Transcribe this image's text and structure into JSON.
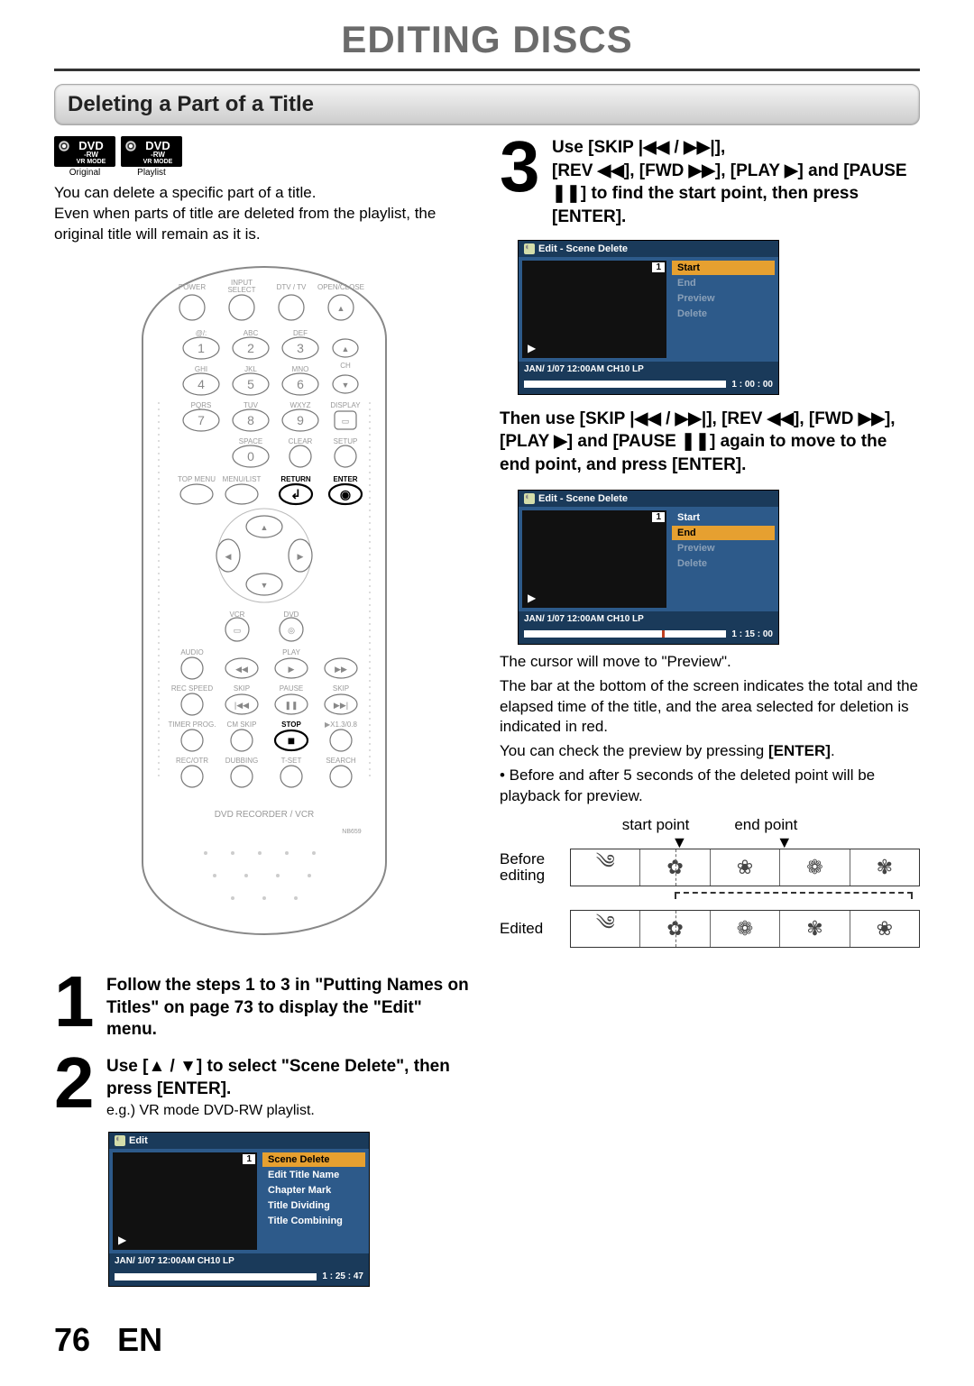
{
  "page_title": "EDITING DISCS",
  "section_title": "Deleting a Part of a Title",
  "badges": [
    {
      "line1": "DVD",
      "line2": "-RW",
      "line3": "VR MODE",
      "sub": "Original"
    },
    {
      "line1": "DVD",
      "line2": "-RW",
      "line3": "VR MODE",
      "sub": "Playlist"
    }
  ],
  "intro_lines": [
    "You can delete a specific part of a title.",
    "Even when parts of title are deleted from the playlist, the original title will remain as it is."
  ],
  "remote": {
    "rows": [
      [
        "POWER",
        "INPUT SELECT",
        "DTV / TV",
        "OPEN/CLOSE"
      ],
      [
        "@/:",
        "ABC",
        "DEF",
        ""
      ],
      [
        "1",
        "2",
        "3",
        "▲"
      ],
      [
        "GHI",
        "JKL",
        "MNO",
        "CH"
      ],
      [
        "4",
        "5",
        "6",
        "▼"
      ],
      [
        "PQRS",
        "TUV",
        "WXYZ",
        "DISPLAY"
      ],
      [
        "7",
        "8",
        "9",
        "■"
      ],
      [
        "",
        "SPACE",
        "CLEAR",
        "SETUP"
      ],
      [
        "",
        "0",
        "",
        ""
      ],
      [
        "TOP MENU",
        "MENU/LIST",
        "RETURN",
        "ENTER"
      ]
    ],
    "vcr_dvd": [
      "VCR",
      "DVD"
    ],
    "transport": [
      [
        "AUDIO",
        "",
        "PLAY",
        ""
      ],
      [
        "",
        "◀◀",
        "▶",
        "▶▶"
      ],
      [
        "REC SPEED",
        "SKIP",
        "PAUSE",
        "SKIP"
      ],
      [
        "",
        "|◀◀",
        "❚❚",
        "▶▶|"
      ],
      [
        "TIMER PROG.",
        "CM SKIP",
        "STOP",
        "▶X1.3/0.8"
      ],
      [
        "",
        "",
        "■",
        ""
      ],
      [
        "REC/OTR",
        "DUBBING",
        "T-SET",
        "SEARCH"
      ]
    ],
    "brand": "DVD RECORDER / VCR",
    "model": "NB659"
  },
  "step1": {
    "num": "1",
    "text": "Follow the steps 1 to 3 in \"Putting Names on Titles\" on page 73 to display the \"Edit\" menu."
  },
  "step2": {
    "num": "2",
    "text": "Use [▲ / ▼] to select \"Scene Delete\", then press [ENTER].",
    "sub": "e.g.) VR mode DVD-RW playlist.",
    "osd": {
      "title": "Edit",
      "preview_num": "1",
      "options": [
        "Scene Delete",
        "Edit Title Name",
        "Chapter Mark",
        "Title Dividing",
        "Title Combining"
      ],
      "highlight_index": 0,
      "info": "JAN/ 1/07 12:00AM CH10   LP",
      "time": "1 : 25 : 47"
    }
  },
  "step3": {
    "num": "3",
    "head_a": "Use [SKIP |◀◀ / ▶▶|],",
    "head_b": "[REV ◀◀], [FWD ▶▶], [PLAY ▶] and [PAUSE ❚❚] to find the start point, then press [ENTER].",
    "osd1": {
      "title": "Edit - Scene Delete",
      "preview_num": "1",
      "options": [
        "Start",
        "End",
        "Preview",
        "Delete"
      ],
      "highlight_index": 0,
      "info": "JAN/ 1/07 12:00AM CH10   LP",
      "time": "1 : 00 : 00"
    },
    "mid": "Then use [SKIP |◀◀ / ▶▶|], [REV ◀◀], [FWD ▶▶], [PLAY ▶] and [PAUSE ❚❚] again to move to the end point, and press [ENTER].",
    "osd2": {
      "title": "Edit - Scene Delete",
      "preview_num": "1",
      "options": [
        "Start",
        "End",
        "Preview",
        "Delete"
      ],
      "highlight_index": 1,
      "info": "JAN/ 1/07 12:00AM CH10   LP",
      "time": "1 : 15 : 00"
    },
    "after": [
      "The cursor will move to \"Preview\".",
      "The bar at the bottom of the screen indicates the total and the elapsed time of the title, and the area selected for deletion is indicated in red.",
      "You can check the preview by pressing [ENTER].",
      "• Before and after 5 seconds of the deleted point will be playback for preview."
    ]
  },
  "diagram": {
    "start_label": "start point",
    "end_label": "end point",
    "before_label": "Before editing",
    "edited_label": "Edited",
    "glyph_sets": {
      "before": [
        "༄",
        "✿",
        "❀",
        "❁",
        "✾"
      ],
      "edited": [
        "༄",
        "✿",
        "❁",
        "✾",
        "❀"
      ]
    }
  },
  "footer": {
    "page": "76",
    "lang": "EN"
  }
}
